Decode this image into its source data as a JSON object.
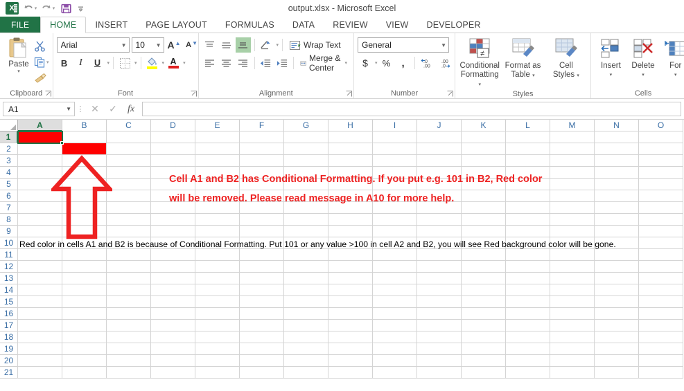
{
  "window": {
    "title": "output.xlsx - Microsoft Excel"
  },
  "quick_access": {
    "app_icon": "excel-logo-icon",
    "items": [
      {
        "name": "undo-icon",
        "label": "Undo"
      },
      {
        "name": "redo-icon",
        "label": "Redo"
      },
      {
        "name": "save-icon",
        "label": "Save"
      },
      {
        "name": "customize-qat-icon",
        "label": "Customize Quick Access Toolbar"
      }
    ]
  },
  "tabs": [
    {
      "label": "FILE",
      "active": false,
      "file": true
    },
    {
      "label": "HOME",
      "active": true,
      "file": false
    },
    {
      "label": "INSERT",
      "active": false,
      "file": false
    },
    {
      "label": "PAGE LAYOUT",
      "active": false,
      "file": false
    },
    {
      "label": "FORMULAS",
      "active": false,
      "file": false
    },
    {
      "label": "DATA",
      "active": false,
      "file": false
    },
    {
      "label": "REVIEW",
      "active": false,
      "file": false
    },
    {
      "label": "VIEW",
      "active": false,
      "file": false
    },
    {
      "label": "DEVELOPER",
      "active": false,
      "file": false
    }
  ],
  "ribbon": {
    "clipboard": {
      "group_label": "Clipboard",
      "paste_label": "Paste",
      "cut_label": "Cut",
      "copy_label": "Copy",
      "format_painter_label": "Format Painter"
    },
    "font": {
      "group_label": "Font",
      "font_name": "Arial",
      "font_size": "10",
      "grow_font_label": "A",
      "shrink_font_label": "A",
      "bold_label": "B",
      "italic_label": "I",
      "underline_label": "U",
      "borders_label": "Borders",
      "fill_color_label": "Fill Color",
      "font_color_label": "A"
    },
    "alignment": {
      "group_label": "Alignment",
      "wrap_text_label": "Wrap Text",
      "merge_center_label": "Merge & Center"
    },
    "number": {
      "group_label": "Number",
      "number_format": "General",
      "currency_label": "$",
      "percent_label": "%",
      "comma_label": ",",
      "increase_decimal_label": ".00",
      "decrease_decimal_label": ".00"
    },
    "styles": {
      "group_label": "Styles",
      "buttons": [
        {
          "line1": "Conditional",
          "line2": "Formatting",
          "caret": true
        },
        {
          "line1": "Format as",
          "line2": "Table",
          "caret": true
        },
        {
          "line1": "Cell",
          "line2": "Styles",
          "caret": true
        }
      ]
    },
    "cells": {
      "group_label": "Cells",
      "buttons": [
        {
          "line1": "Insert",
          "line2": "",
          "caret": true
        },
        {
          "line1": "Delete",
          "line2": "",
          "caret": true
        },
        {
          "line1": "For",
          "line2": "",
          "caret": true
        }
      ]
    }
  },
  "formula_bar": {
    "name_box": "A1",
    "cancel_label": "✕",
    "enter_label": "✓",
    "function_label": "fx",
    "formula_value": ""
  },
  "grid": {
    "columns": [
      "A",
      "B",
      "C",
      "D",
      "E",
      "F",
      "G",
      "H",
      "I",
      "J",
      "K",
      "L",
      "M",
      "N",
      "O"
    ],
    "selected_column": "A",
    "rows": [
      "1",
      "2",
      "3",
      "4",
      "5",
      "6",
      "7",
      "8",
      "9",
      "10",
      "11",
      "12",
      "13",
      "14",
      "15",
      "16",
      "17",
      "18",
      "19",
      "20",
      "21"
    ],
    "selected_row": "1",
    "active_cell": "A1",
    "conditional_fill_color": "#ff0000",
    "selection_border_color": "#217346",
    "filled_cells": [
      {
        "ref": "A1",
        "col": 0,
        "row": 0,
        "fill": "#ff0000",
        "value": ""
      },
      {
        "ref": "B2",
        "col": 1,
        "row": 1,
        "fill": "#ff0000",
        "value": ""
      }
    ],
    "annotations": {
      "red_message_line1": "Cell A1 and B2 has Conditional Formatting. If you put e.g. 101 in B2, Red color",
      "red_message_line2": "will be removed. Please read message in A10 for more help.",
      "red_message_color": "#ee2222",
      "arrow_shape_name": "up-arrow-shape",
      "arrow_color": "#ee2222"
    },
    "cell_a10_text": "Red color in cells A1 and B2 is because of Conditional Formatting. Put 101 or any value >100 in cell A2 and B2, you will see Red background color will be gone."
  }
}
